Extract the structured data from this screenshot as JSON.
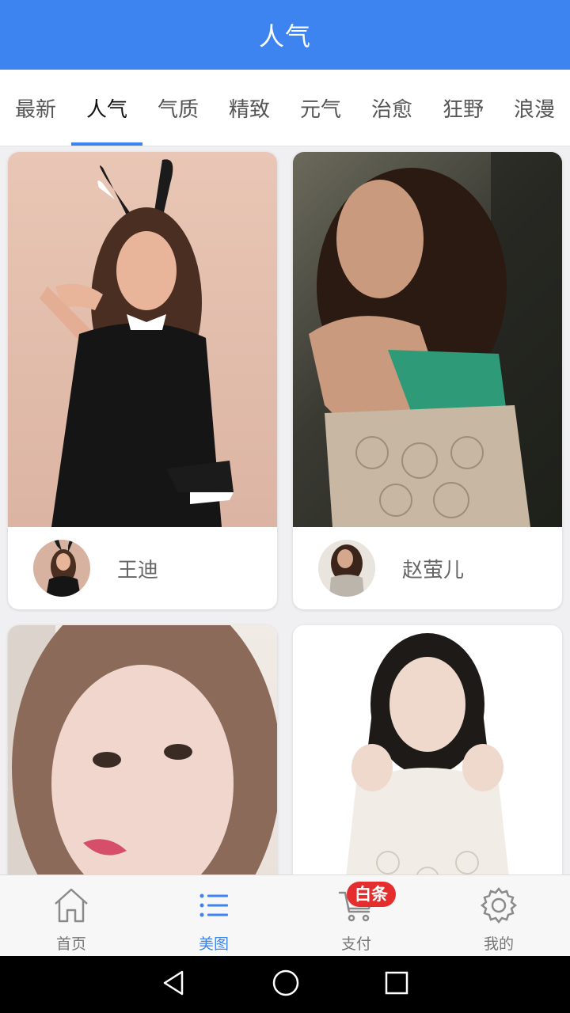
{
  "header": {
    "title": "人气"
  },
  "tabs": [
    {
      "label": "最新"
    },
    {
      "label": "人气",
      "active": true
    },
    {
      "label": "气质"
    },
    {
      "label": "精致"
    },
    {
      "label": "元气"
    },
    {
      "label": "治愈"
    },
    {
      "label": "狂野"
    },
    {
      "label": "浪漫"
    }
  ],
  "cards": [
    {
      "name": "王迪"
    },
    {
      "name": "赵萤儿"
    },
    {
      "name": ""
    },
    {
      "name": ""
    }
  ],
  "bottom_nav": {
    "items": [
      {
        "label": "首页",
        "icon": "home-icon"
      },
      {
        "label": "美图",
        "icon": "list-icon",
        "active": true
      },
      {
        "label": "支付",
        "icon": "cart-icon",
        "badge": "白条"
      },
      {
        "label": "我的",
        "icon": "gear-icon"
      }
    ]
  },
  "colors": {
    "accent": "#3d84f1",
    "badge": "#e62d2d"
  }
}
